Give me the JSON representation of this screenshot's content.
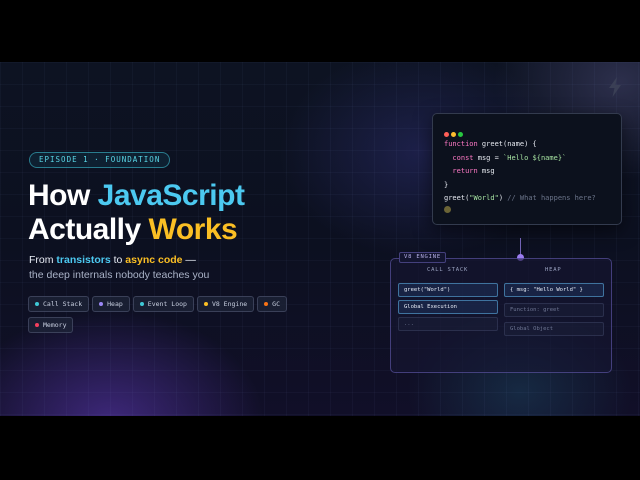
{
  "badge": "EPISODE 1 · FOUNDATION",
  "headline": {
    "line1_plain": "How ",
    "line1_accent": "JavaScript",
    "line2_plain": "Actually ",
    "line2_accent": "Works"
  },
  "subtitle": {
    "from": "From ",
    "transistors": "transistors",
    "to": " to ",
    "async_code": "async code",
    "dash": " —",
    "line2": "the deep internals nobody teaches you"
  },
  "chips": [
    {
      "label": "Call Stack",
      "dot": "#3fc9d6"
    },
    {
      "label": "Heap",
      "dot": "#9b87f5"
    },
    {
      "label": "Event Loop",
      "dot": "#3fc9d6"
    },
    {
      "label": "V8 Engine",
      "dot": "#fbbf24"
    },
    {
      "label": "GC",
      "dot": "#f97316"
    },
    {
      "label": "Memory",
      "dot": "#f43f5e"
    }
  ],
  "code_window": {
    "traffic_lights": [
      "#ff5f57",
      "#febc2e",
      "#28c840"
    ],
    "lines": {
      "l1_kw": "function",
      "l1_rest": " greet(name) {",
      "l2_kw": "  const",
      "l2_mid": " msg = ",
      "l2_str": "`Hello ${name}`",
      "l3_kw": "  return",
      "l3_rest": " msg",
      "l4": "}",
      "l5_call": "greet(",
      "l5_str": "\"World\"",
      "l5_close": ")",
      "l5_comment": " // What happens here?"
    }
  },
  "engine": {
    "tag": "V8 ENGINE",
    "call_stack_title": "CALL STACK",
    "heap_title": "HEAP",
    "call_stack": [
      "greet(\"World\")",
      "Global Execution",
      "..."
    ],
    "heap": [
      "{ msg: \"Hello World\" }",
      "Function: greet",
      "Global Object"
    ]
  },
  "colors": {
    "accent_blue": "#4cc9f0",
    "accent_gold": "#fbbf24",
    "background": "#0d1322"
  },
  "icons": {
    "top_right": "lightning-bolt-icon"
  }
}
